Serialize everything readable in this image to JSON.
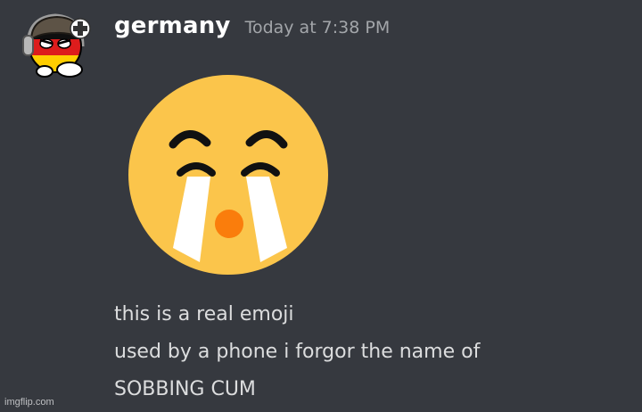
{
  "message": {
    "username": "germany",
    "timestamp": "Today at 7:38 PM",
    "lines": [
      "this is a real emoji",
      "used by a phone i forgor the name of",
      "SOBBING CUM"
    ]
  },
  "emoji": {
    "name": "sobbing-face-emoji",
    "face_color": "#fbc54b",
    "tear_color": "#ffffff",
    "mouth_color": "#fa7d0c"
  },
  "avatar": {
    "name": "germany-countryball-avatar"
  },
  "watermark": {
    "text": "imgflip.com"
  },
  "colors": {
    "background": "#36393f",
    "username": "#ffffff",
    "timestamp": "#a3a6aa",
    "message_text": "#dcddde"
  }
}
